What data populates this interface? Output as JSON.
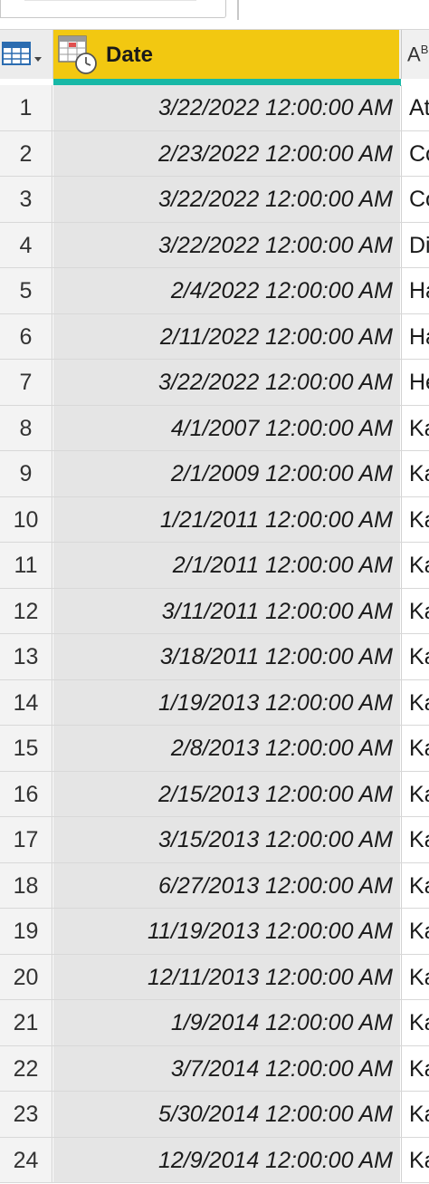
{
  "header": {
    "date_column_title": "Date",
    "next_column_type_glyph": "A",
    "next_column_type_sup": "B"
  },
  "icons": {
    "corner": "table-icon",
    "date_type": "calendar-clock-icon",
    "dropdown": "chevron-down-icon"
  },
  "colors": {
    "header_accent": "#f2c811",
    "quality_bar": "#17b8a6"
  },
  "rows": [
    {
      "num": "1",
      "date": "3/22/2022 12:00:00 AM",
      "text": "At"
    },
    {
      "num": "2",
      "date": "2/23/2022 12:00:00 AM",
      "text": "Co"
    },
    {
      "num": "3",
      "date": "3/22/2022 12:00:00 AM",
      "text": "Co"
    },
    {
      "num": "4",
      "date": "3/22/2022 12:00:00 AM",
      "text": "Di"
    },
    {
      "num": "5",
      "date": "2/4/2022 12:00:00 AM",
      "text": "Ha"
    },
    {
      "num": "6",
      "date": "2/11/2022 12:00:00 AM",
      "text": "Ha"
    },
    {
      "num": "7",
      "date": "3/22/2022 12:00:00 AM",
      "text": "He"
    },
    {
      "num": "8",
      "date": "4/1/2007 12:00:00 AM",
      "text": "Ka"
    },
    {
      "num": "9",
      "date": "2/1/2009 12:00:00 AM",
      "text": "Ka"
    },
    {
      "num": "10",
      "date": "1/21/2011 12:00:00 AM",
      "text": "Ka"
    },
    {
      "num": "11",
      "date": "2/1/2011 12:00:00 AM",
      "text": "Ka"
    },
    {
      "num": "12",
      "date": "3/11/2011 12:00:00 AM",
      "text": "Ka"
    },
    {
      "num": "13",
      "date": "3/18/2011 12:00:00 AM",
      "text": "Ka"
    },
    {
      "num": "14",
      "date": "1/19/2013 12:00:00 AM",
      "text": "Ka"
    },
    {
      "num": "15",
      "date": "2/8/2013 12:00:00 AM",
      "text": "Ka"
    },
    {
      "num": "16",
      "date": "2/15/2013 12:00:00 AM",
      "text": "Ka"
    },
    {
      "num": "17",
      "date": "3/15/2013 12:00:00 AM",
      "text": "Ka"
    },
    {
      "num": "18",
      "date": "6/27/2013 12:00:00 AM",
      "text": "Ka"
    },
    {
      "num": "19",
      "date": "11/19/2013 12:00:00 AM",
      "text": "Ka"
    },
    {
      "num": "20",
      "date": "12/11/2013 12:00:00 AM",
      "text": "Ka"
    },
    {
      "num": "21",
      "date": "1/9/2014 12:00:00 AM",
      "text": "Ka"
    },
    {
      "num": "22",
      "date": "3/7/2014 12:00:00 AM",
      "text": "Ka"
    },
    {
      "num": "23",
      "date": "5/30/2014 12:00:00 AM",
      "text": "Ka"
    },
    {
      "num": "24",
      "date": "12/9/2014 12:00:00 AM",
      "text": "Ka"
    }
  ]
}
